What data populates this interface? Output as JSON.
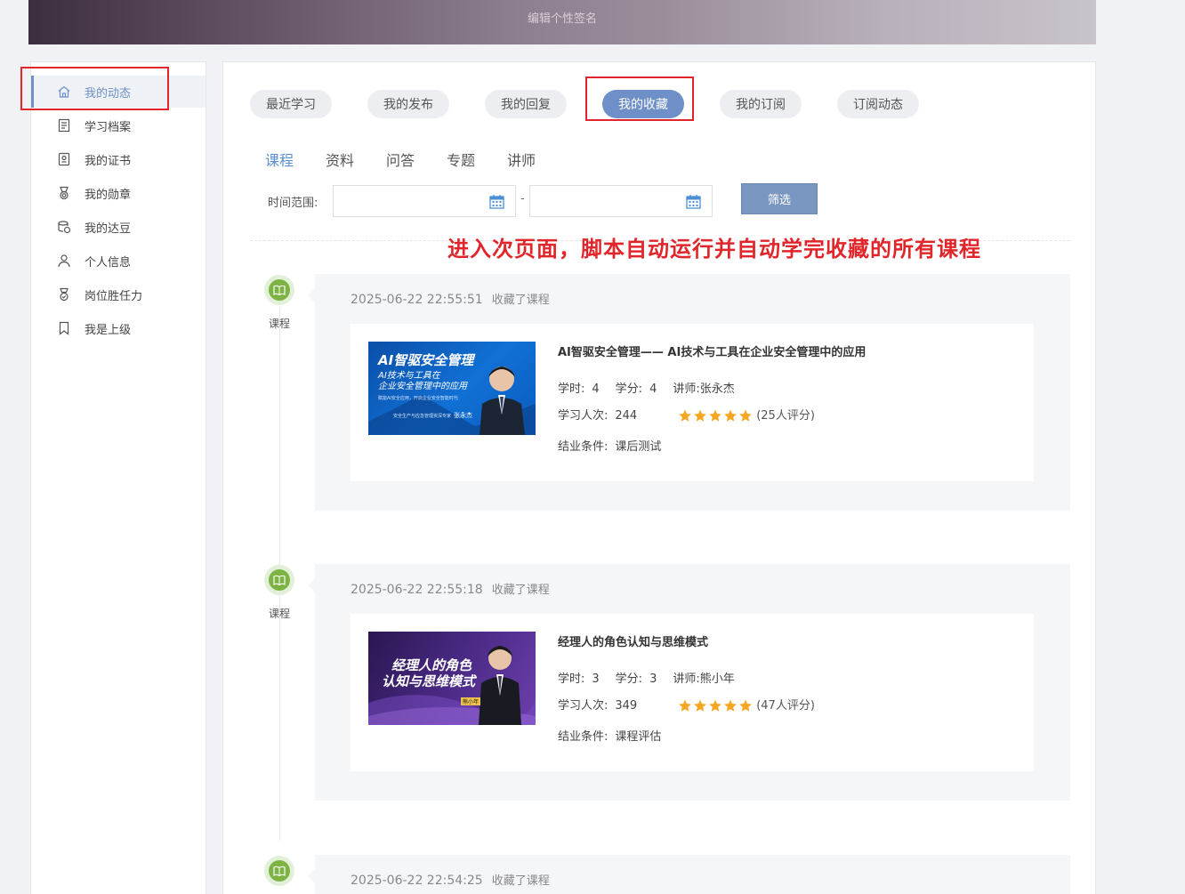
{
  "banner": {
    "signature_edit": "编辑个性签名"
  },
  "sidebar": {
    "items": [
      {
        "label": "我的动态",
        "icon": "home-icon"
      },
      {
        "label": "学习档案",
        "icon": "document-icon"
      },
      {
        "label": "我的证书",
        "icon": "certificate-icon"
      },
      {
        "label": "我的勋章",
        "icon": "medal-icon"
      },
      {
        "label": "我的达豆",
        "icon": "coins-icon"
      },
      {
        "label": "个人信息",
        "icon": "user-icon"
      },
      {
        "label": "岗位胜任力",
        "icon": "badge-icon"
      },
      {
        "label": "我是上级",
        "icon": "bookmark-icon"
      }
    ]
  },
  "tabs": [
    "最近学习",
    "我的发布",
    "我的回复",
    "我的收藏",
    "我的订阅",
    "订阅动态"
  ],
  "subtabs": [
    "课程",
    "资料",
    "问答",
    "专题",
    "讲师"
  ],
  "filter": {
    "time_label": "时间范围:",
    "separator": "-",
    "button": "筛选"
  },
  "annotation": "进入次页面，脚本自动运行并自动学完收藏的所有课程",
  "accent_color": "#6e8fc7",
  "entries": [
    {
      "type_label": "课程",
      "timestamp": "2025-06-22 22:55:51",
      "action": "收藏了课程",
      "course": {
        "title": "AI智驱安全管理—— AI技术与工具在企业安全管理中的应用",
        "hours_label": "学时:",
        "hours": "4",
        "credits_label": "学分:",
        "credits": "4",
        "lecturer_label": "讲师:",
        "lecturer": "张永杰",
        "learners_label": "学习人次:",
        "learners": "244",
        "stars": 5,
        "rating_text": "(25人评分)",
        "completion_label": "结业条件:",
        "completion": "课后测试",
        "thumb_title_1": "AI智驱安全管理",
        "thumb_title_2": "AI技术与工具在",
        "thumb_title_3": "企业安全管理中的应用",
        "thumb_line_4": "赋能AI安全应用，开启企业安全智能时代",
        "thumb_line_5": "安全生产与应急管理资深专家",
        "thumb_name": "张永杰"
      }
    },
    {
      "type_label": "课程",
      "timestamp": "2025-06-22 22:55:18",
      "action": "收藏了课程",
      "course": {
        "title": "经理人的角色认知与思维模式",
        "hours_label": "学时:",
        "hours": "3",
        "credits_label": "学分:",
        "credits": "3",
        "lecturer_label": "讲师:",
        "lecturer": "熊小年",
        "learners_label": "学习人次:",
        "learners": "349",
        "stars": 5,
        "rating_text": "(47人评分)",
        "completion_label": "结业条件:",
        "completion": "课程评估",
        "thumb_title_1": "经理人的角色",
        "thumb_title_2": "认知与思维模式",
        "thumb_name": "熊小年"
      }
    },
    {
      "type_label": "课程",
      "timestamp": "2025-06-22 22:54:25",
      "action": "收藏了课程"
    }
  ]
}
